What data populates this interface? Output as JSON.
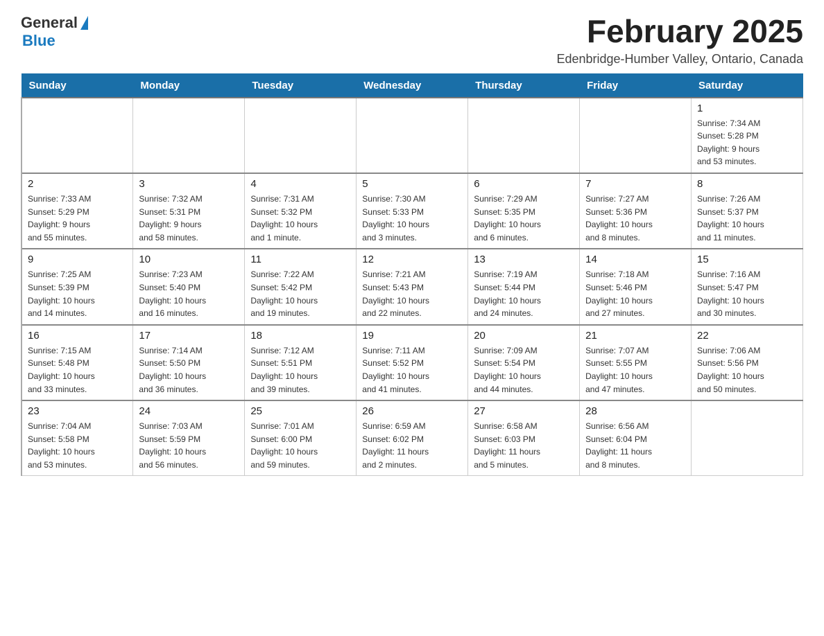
{
  "header": {
    "logo_general": "General",
    "logo_blue": "Blue",
    "month_year": "February 2025",
    "location": "Edenbridge-Humber Valley, Ontario, Canada"
  },
  "days_of_week": [
    "Sunday",
    "Monday",
    "Tuesday",
    "Wednesday",
    "Thursday",
    "Friday",
    "Saturday"
  ],
  "weeks": [
    [
      {
        "day": "",
        "info": ""
      },
      {
        "day": "",
        "info": ""
      },
      {
        "day": "",
        "info": ""
      },
      {
        "day": "",
        "info": ""
      },
      {
        "day": "",
        "info": ""
      },
      {
        "day": "",
        "info": ""
      },
      {
        "day": "1",
        "info": "Sunrise: 7:34 AM\nSunset: 5:28 PM\nDaylight: 9 hours\nand 53 minutes."
      }
    ],
    [
      {
        "day": "2",
        "info": "Sunrise: 7:33 AM\nSunset: 5:29 PM\nDaylight: 9 hours\nand 55 minutes."
      },
      {
        "day": "3",
        "info": "Sunrise: 7:32 AM\nSunset: 5:31 PM\nDaylight: 9 hours\nand 58 minutes."
      },
      {
        "day": "4",
        "info": "Sunrise: 7:31 AM\nSunset: 5:32 PM\nDaylight: 10 hours\nand 1 minute."
      },
      {
        "day": "5",
        "info": "Sunrise: 7:30 AM\nSunset: 5:33 PM\nDaylight: 10 hours\nand 3 minutes."
      },
      {
        "day": "6",
        "info": "Sunrise: 7:29 AM\nSunset: 5:35 PM\nDaylight: 10 hours\nand 6 minutes."
      },
      {
        "day": "7",
        "info": "Sunrise: 7:27 AM\nSunset: 5:36 PM\nDaylight: 10 hours\nand 8 minutes."
      },
      {
        "day": "8",
        "info": "Sunrise: 7:26 AM\nSunset: 5:37 PM\nDaylight: 10 hours\nand 11 minutes."
      }
    ],
    [
      {
        "day": "9",
        "info": "Sunrise: 7:25 AM\nSunset: 5:39 PM\nDaylight: 10 hours\nand 14 minutes."
      },
      {
        "day": "10",
        "info": "Sunrise: 7:23 AM\nSunset: 5:40 PM\nDaylight: 10 hours\nand 16 minutes."
      },
      {
        "day": "11",
        "info": "Sunrise: 7:22 AM\nSunset: 5:42 PM\nDaylight: 10 hours\nand 19 minutes."
      },
      {
        "day": "12",
        "info": "Sunrise: 7:21 AM\nSunset: 5:43 PM\nDaylight: 10 hours\nand 22 minutes."
      },
      {
        "day": "13",
        "info": "Sunrise: 7:19 AM\nSunset: 5:44 PM\nDaylight: 10 hours\nand 24 minutes."
      },
      {
        "day": "14",
        "info": "Sunrise: 7:18 AM\nSunset: 5:46 PM\nDaylight: 10 hours\nand 27 minutes."
      },
      {
        "day": "15",
        "info": "Sunrise: 7:16 AM\nSunset: 5:47 PM\nDaylight: 10 hours\nand 30 minutes."
      }
    ],
    [
      {
        "day": "16",
        "info": "Sunrise: 7:15 AM\nSunset: 5:48 PM\nDaylight: 10 hours\nand 33 minutes."
      },
      {
        "day": "17",
        "info": "Sunrise: 7:14 AM\nSunset: 5:50 PM\nDaylight: 10 hours\nand 36 minutes."
      },
      {
        "day": "18",
        "info": "Sunrise: 7:12 AM\nSunset: 5:51 PM\nDaylight: 10 hours\nand 39 minutes."
      },
      {
        "day": "19",
        "info": "Sunrise: 7:11 AM\nSunset: 5:52 PM\nDaylight: 10 hours\nand 41 minutes."
      },
      {
        "day": "20",
        "info": "Sunrise: 7:09 AM\nSunset: 5:54 PM\nDaylight: 10 hours\nand 44 minutes."
      },
      {
        "day": "21",
        "info": "Sunrise: 7:07 AM\nSunset: 5:55 PM\nDaylight: 10 hours\nand 47 minutes."
      },
      {
        "day": "22",
        "info": "Sunrise: 7:06 AM\nSunset: 5:56 PM\nDaylight: 10 hours\nand 50 minutes."
      }
    ],
    [
      {
        "day": "23",
        "info": "Sunrise: 7:04 AM\nSunset: 5:58 PM\nDaylight: 10 hours\nand 53 minutes."
      },
      {
        "day": "24",
        "info": "Sunrise: 7:03 AM\nSunset: 5:59 PM\nDaylight: 10 hours\nand 56 minutes."
      },
      {
        "day": "25",
        "info": "Sunrise: 7:01 AM\nSunset: 6:00 PM\nDaylight: 10 hours\nand 59 minutes."
      },
      {
        "day": "26",
        "info": "Sunrise: 6:59 AM\nSunset: 6:02 PM\nDaylight: 11 hours\nand 2 minutes."
      },
      {
        "day": "27",
        "info": "Sunrise: 6:58 AM\nSunset: 6:03 PM\nDaylight: 11 hours\nand 5 minutes."
      },
      {
        "day": "28",
        "info": "Sunrise: 6:56 AM\nSunset: 6:04 PM\nDaylight: 11 hours\nand 8 minutes."
      },
      {
        "day": "",
        "info": ""
      }
    ]
  ]
}
